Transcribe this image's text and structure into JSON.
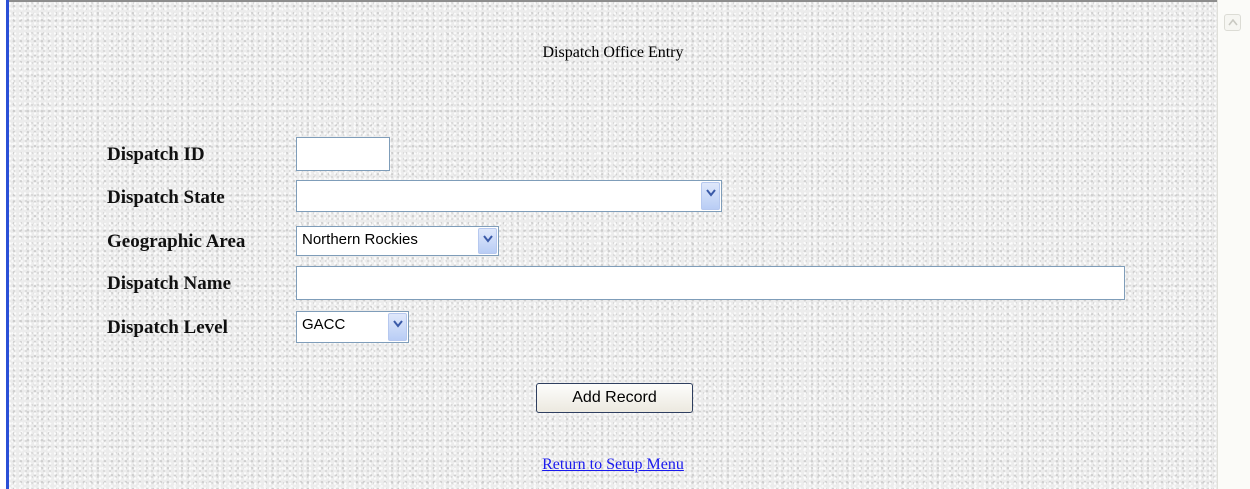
{
  "form": {
    "title": "Dispatch Office Entry",
    "fields": {
      "dispatch_id": {
        "label": "Dispatch ID",
        "value": ""
      },
      "dispatch_state": {
        "label": "Dispatch State",
        "value": ""
      },
      "geographic_area": {
        "label": "Geographic Area",
        "value": "Northern Rockies"
      },
      "dispatch_name": {
        "label": "Dispatch Name",
        "value": ""
      },
      "dispatch_level": {
        "label": "Dispatch Level",
        "value": "GACC"
      }
    },
    "add_button_label": "Add Record",
    "return_link_text": "Return to Setup Menu"
  },
  "colors": {
    "accent_bar": "#2a4fd6",
    "link": "#1a1aee",
    "field_border": "#7f9db9"
  }
}
